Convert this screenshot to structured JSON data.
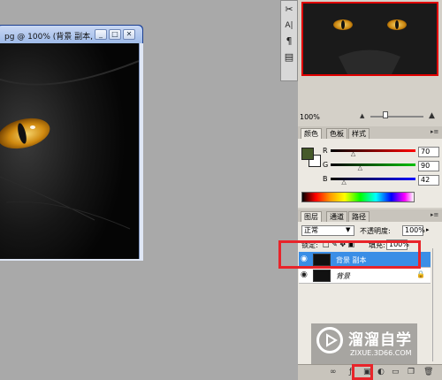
{
  "document": {
    "title": "pg @ 100% (背景 副本, ...",
    "buttons": {
      "minimize": "_",
      "restore": "□",
      "close": "✕"
    }
  },
  "tools": [
    {
      "icon": "scissors-icon",
      "glyph": "✂"
    },
    {
      "icon": "type-tool-icon",
      "glyph": "A|"
    },
    {
      "icon": "paragraph-icon",
      "glyph": "¶"
    },
    {
      "icon": "notes-tool-icon",
      "glyph": "▤"
    }
  ],
  "navigator": {
    "zoom": "100%"
  },
  "color_panel": {
    "tabs": [
      "颜色",
      "色板",
      "样式"
    ],
    "channels": [
      {
        "label": "R",
        "value": "70",
        "knob": 0.27,
        "color": "#ff0000"
      },
      {
        "label": "G",
        "value": "90",
        "knob": 0.35,
        "color": "#00c000"
      },
      {
        "label": "B",
        "value": "42",
        "knob": 0.16,
        "color": "#0000ff"
      }
    ],
    "foreground": "#465a2a",
    "background": "#ffffff"
  },
  "layers_panel": {
    "tabs": [
      "图层",
      "通道",
      "路径"
    ],
    "blend_mode": "正常",
    "opacity_label": "不透明度:",
    "opacity": "100%",
    "lock_label": "锁定:",
    "fill_label": "填充:",
    "fill": "100%",
    "layers": [
      {
        "name": "背景 副本",
        "selected": true
      },
      {
        "name": "背景",
        "selected": false
      }
    ]
  },
  "watermark": {
    "title": "溜溜自学",
    "url": "ZIXUE.3D66.COM"
  },
  "colors": {
    "highlight": "#e8242a",
    "selection": "#3a8ee6"
  }
}
